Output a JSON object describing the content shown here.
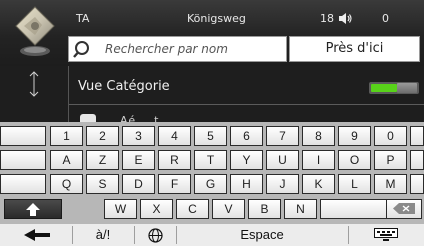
{
  "status": {
    "ta": "TA",
    "street": "Königsweg",
    "number": "18",
    "extra": "0"
  },
  "search": {
    "placeholder": "Rechercher par nom",
    "near_label": "Près d'ici"
  },
  "list": {
    "category_label": "Vue Catégorie",
    "toggle_on": true,
    "partial_row_text": "Aé... t"
  },
  "keyboard": {
    "rows": [
      [
        "1",
        "2",
        "3",
        "4",
        "5",
        "6",
        "7",
        "8",
        "9",
        "0"
      ],
      [
        "A",
        "Z",
        "E",
        "R",
        "T",
        "Y",
        "U",
        "I",
        "O",
        "P"
      ],
      [
        "Q",
        "S",
        "D",
        "F",
        "G",
        "H",
        "J",
        "K",
        "L",
        "M"
      ],
      [
        "W",
        "X",
        "C",
        "V",
        "B",
        "N"
      ]
    ],
    "mode_key": "à/!",
    "space_key": "Espace"
  },
  "colors": {
    "toggle_on": "#58d21a",
    "keyboard_bg": "#b7b7b7",
    "header_bg": "#2e2e2e"
  },
  "icons": [
    "map-logo-icon",
    "volume-icon",
    "search-icon",
    "scroll-arrows-icon",
    "shift-icon",
    "backspace-icon",
    "back-arrow-icon",
    "globe-icon",
    "keyboard-hide-icon"
  ]
}
